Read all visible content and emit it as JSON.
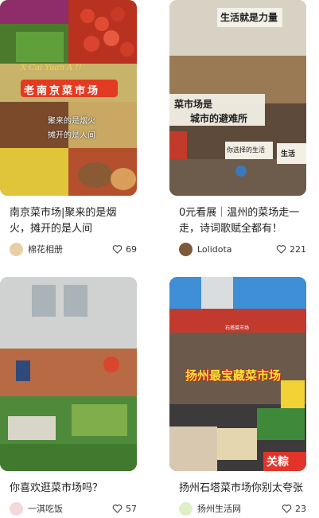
{
  "feed": {
    "cards": [
      {
        "title": "南京菜市场|聚来的是烟火，摊开的是人间",
        "author": "棉花相册",
        "likes": "69",
        "overlay_pinyin": "X Cai Yuan A !!",
        "overlay_banner": "老南京菜市场",
        "overlay_line1": "聚来的是烟火",
        "overlay_line2": "摊开的是人间"
      },
      {
        "title": "0元看展｜温州的菜场走一走，诗词歌赋全都有！",
        "author": "Lolidota",
        "likes": "221",
        "overlay_sign": "生活就是力量",
        "overlay_caption1": "菜市场是",
        "overlay_caption2": "城市的避难所",
        "overlay_sign2": "你选择的生活",
        "overlay_sign3": "生活"
      },
      {
        "title": "你喜欢逛菜市场吗？",
        "author": "一淇吃饭",
        "likes": "57"
      },
      {
        "title": "扬州石塔菜市场你别太夸张",
        "author": "扬州生活网",
        "likes": "23",
        "overlay_caption": "扬州最宝藏菜市场",
        "overlay_sign": "石塔菜市场",
        "overlay_bottom": "关粽"
      }
    ]
  },
  "icons": {
    "like": "heart-outline-icon"
  }
}
